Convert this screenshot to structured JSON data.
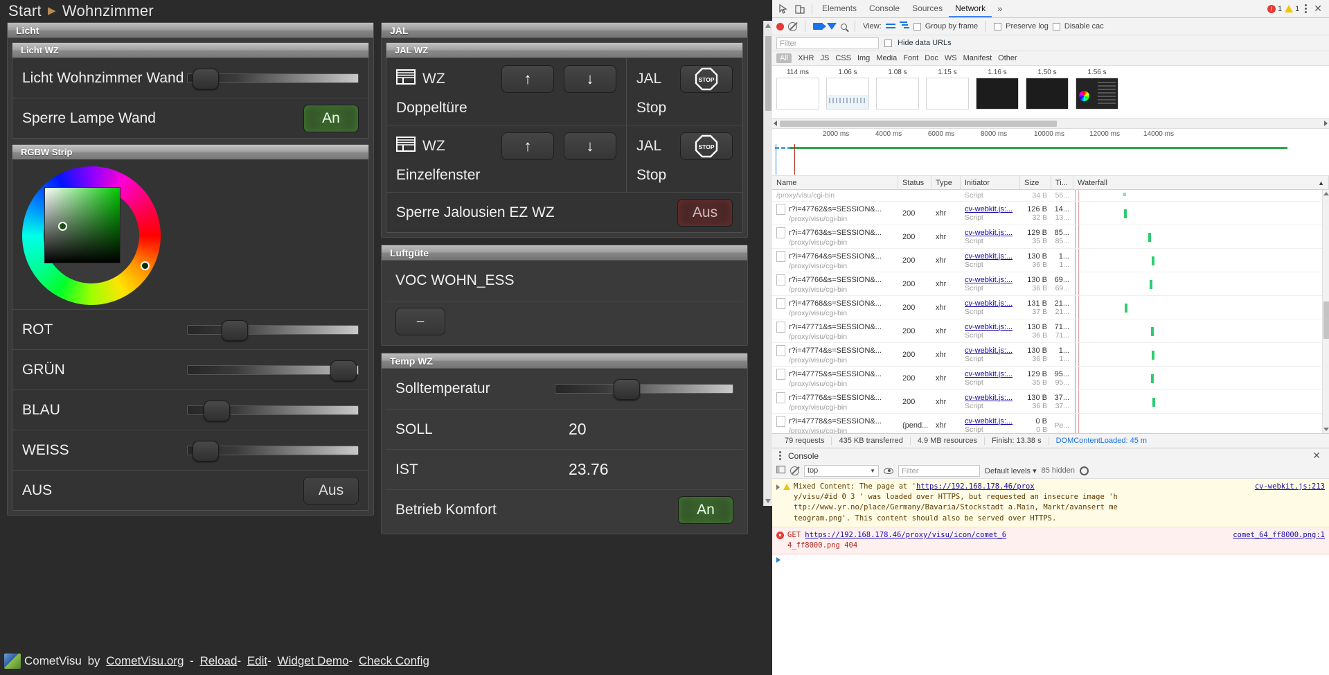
{
  "cometvisu": {
    "breadcrumb": {
      "root": "Start",
      "separator": "▶",
      "current": "Wohnzimmer"
    },
    "groups": {
      "licht": {
        "title": "Licht",
        "subgroups": [
          {
            "title": "Licht WZ",
            "rows": [
              {
                "label": "Licht Wohnzimmer Wand",
                "type": "slider",
                "knob_percent": 8
              },
              {
                "label": "Sperre Lampe Wand",
                "type": "switch",
                "value": "An",
                "state": "on"
              }
            ]
          },
          {
            "title": "RGBW Strip",
            "rows": [
              {
                "label": "ROT",
                "type": "slider",
                "knob_percent": 21
              },
              {
                "label": "GRÜN",
                "type": "slider",
                "knob_percent": 85
              },
              {
                "label": "BLAU",
                "type": "slider",
                "knob_percent": 13
              },
              {
                "label": "WEISS",
                "type": "slider",
                "knob_percent": 8
              },
              {
                "label": "AUS",
                "type": "switch",
                "value": "Aus",
                "state": "plain"
              }
            ]
          }
        ]
      },
      "jal": {
        "title": "JAL",
        "subgroup_title": "JAL WZ",
        "rows": [
          {
            "icon": "blinds-icon",
            "title": "WZ",
            "subtitle": "Doppeltüre",
            "up_label": "↑",
            "down_label": "↓",
            "right_title": "JAL",
            "right_subtitle": "Stop",
            "stop_label": "STOP"
          },
          {
            "icon": "blinds-icon",
            "title": "WZ",
            "subtitle": "Einzelfenster",
            "up_label": "↑",
            "down_label": "↓",
            "right_title": "JAL",
            "right_subtitle": "Stop",
            "stop_label": "STOP"
          }
        ],
        "lock_row": {
          "label": "Sperre Jalousien EZ WZ",
          "value": "Aus",
          "state": "off-red"
        }
      },
      "luftguete": {
        "title": "Luftgüte",
        "sensor_label": "VOC WOHN_ESS",
        "button_label": "–"
      },
      "temp": {
        "title": "Temp WZ",
        "rows": [
          {
            "label": "Solltemperatur",
            "type": "slider",
            "knob_percent": 35
          },
          {
            "label": "SOLL",
            "type": "value",
            "value": "20"
          },
          {
            "label": "IST",
            "type": "value",
            "value": "23.76"
          },
          {
            "label": "Betrieb Komfort",
            "type": "switch",
            "value": "An",
            "state": "on"
          }
        ]
      }
    },
    "footer": {
      "product": "CometVisu",
      "by": "by",
      "site": "CometVisu.org",
      "links": [
        "Reload",
        "Edit",
        "Widget Demo",
        "Check Config"
      ],
      "dash": "-"
    }
  },
  "devtools": {
    "tabs": [
      {
        "label": "Elements",
        "active": false
      },
      {
        "label": "Console",
        "active": false
      },
      {
        "label": "Sources",
        "active": false
      },
      {
        "label": "Network",
        "active": true
      }
    ],
    "more_label": "»",
    "error_count": "1",
    "warning_count": "1",
    "close_label": "✕",
    "toolbar": {
      "view_label": "View:",
      "group_by_frame": "Group by frame",
      "preserve_log": "Preserve log",
      "disable_cache": "Disable cac"
    },
    "filter": {
      "placeholder": "Filter",
      "hide_data_urls": "Hide data URLs"
    },
    "types": [
      "All",
      "XHR",
      "JS",
      "CSS",
      "Img",
      "Media",
      "Font",
      "Doc",
      "WS",
      "Manifest",
      "Other"
    ],
    "active_type": "All",
    "filmstrip": [
      {
        "time": "114 ms",
        "kind": "blank"
      },
      {
        "time": "1.06 s",
        "kind": "chart"
      },
      {
        "time": "1.08 s",
        "kind": "blank"
      },
      {
        "time": "1.15 s",
        "kind": "blank"
      },
      {
        "time": "1.16 s",
        "kind": "dark"
      },
      {
        "time": "1.50 s",
        "kind": "dark"
      },
      {
        "time": "1.56 s",
        "kind": "cv"
      }
    ],
    "overview_ticks": [
      "2000 ms",
      "4000 ms",
      "6000 ms",
      "8000 ms",
      "10000 ms",
      "12000 ms",
      "14000 ms"
    ],
    "table": {
      "columns": [
        "Name",
        "Status",
        "Type",
        "Initiator",
        "Size",
        "Ti...",
        "Waterfall"
      ],
      "rows": [
        {
          "name": "",
          "path": "/proxy/visu/cgi-bin",
          "status": "",
          "type": "",
          "initiator": "",
          "initiator_sub": "Script",
          "size": "34 B",
          "size_sub": "",
          "time": "56...",
          "time_sub": "",
          "partial": true
        },
        {
          "name": "r?i=47762&s=SESSION&...",
          "path": "/proxy/visu/cgi-bin",
          "status": "200",
          "type": "xhr",
          "initiator": "cv-webkit.js:...",
          "initiator_sub": "Script",
          "size": "126 B",
          "size_sub": "32 B",
          "time": "14...",
          "time_sub": "13...",
          "partial": false
        },
        {
          "name": "r?i=47763&s=SESSION&...",
          "path": "/proxy/visu/cgi-bin",
          "status": "200",
          "type": "xhr",
          "initiator": "cv-webkit.js:...",
          "initiator_sub": "Script",
          "size": "129 B",
          "size_sub": "35 B",
          "time": "85...",
          "time_sub": "85...",
          "partial": false
        },
        {
          "name": "r?i=47764&s=SESSION&...",
          "path": "/proxy/visu/cgi-bin",
          "status": "200",
          "type": "xhr",
          "initiator": "cv-webkit.js:...",
          "initiator_sub": "Script",
          "size": "130 B",
          "size_sub": "36 B",
          "time": "1...",
          "time_sub": "1...",
          "partial": false
        },
        {
          "name": "r?i=47766&s=SESSION&...",
          "path": "/proxy/visu/cgi-bin",
          "status": "200",
          "type": "xhr",
          "initiator": "cv-webkit.js:...",
          "initiator_sub": "Script",
          "size": "130 B",
          "size_sub": "36 B",
          "time": "69...",
          "time_sub": "69...",
          "partial": false
        },
        {
          "name": "r?i=47768&s=SESSION&...",
          "path": "/proxy/visu/cgi-bin",
          "status": "200",
          "type": "xhr",
          "initiator": "cv-webkit.js:...",
          "initiator_sub": "Script",
          "size": "131 B",
          "size_sub": "37 B",
          "time": "21...",
          "time_sub": "21...",
          "partial": false
        },
        {
          "name": "r?i=47771&s=SESSION&...",
          "path": "/proxy/visu/cgi-bin",
          "status": "200",
          "type": "xhr",
          "initiator": "cv-webkit.js:...",
          "initiator_sub": "Script",
          "size": "130 B",
          "size_sub": "36 B",
          "time": "71...",
          "time_sub": "71...",
          "partial": false
        },
        {
          "name": "r?i=47774&s=SESSION&...",
          "path": "/proxy/visu/cgi-bin",
          "status": "200",
          "type": "xhr",
          "initiator": "cv-webkit.js:...",
          "initiator_sub": "Script",
          "size": "130 B",
          "size_sub": "36 B",
          "time": "1...",
          "time_sub": "1...",
          "partial": false
        },
        {
          "name": "r?i=47775&s=SESSION&...",
          "path": "/proxy/visu/cgi-bin",
          "status": "200",
          "type": "xhr",
          "initiator": "cv-webkit.js:...",
          "initiator_sub": "Script",
          "size": "129 B",
          "size_sub": "35 B",
          "time": "95...",
          "time_sub": "95...",
          "partial": false
        },
        {
          "name": "r?i=47776&s=SESSION&...",
          "path": "/proxy/visu/cgi-bin",
          "status": "200",
          "type": "xhr",
          "initiator": "cv-webkit.js:...",
          "initiator_sub": "Script",
          "size": "130 B",
          "size_sub": "36 B",
          "time": "37...",
          "time_sub": "37...",
          "partial": false
        },
        {
          "name": "r?i=47778&s=SESSION&...",
          "path": "/proxy/visu/cgi-bin",
          "status": "(pend...",
          "type": "xhr",
          "initiator": "cv-webkit.js:...",
          "initiator_sub": "Script",
          "size": "0 B",
          "size_sub": "0 B",
          "time": "Pe...",
          "time_sub": "",
          "partial": false
        }
      ]
    },
    "summary": {
      "requests": "79 requests",
      "transferred": "435 KB transferred",
      "resources": "4.9 MB resources",
      "finish": "Finish: 13.38 s",
      "domcontentloaded": "DOMContentLoaded: 45 m"
    },
    "console": {
      "title": "Console",
      "context": "top",
      "filter_placeholder": "Filter",
      "levels": "Default levels ▾",
      "hidden_count": "85 hidden",
      "messages": [
        {
          "type": "warn",
          "text_parts": [
            {
              "t": "Mixed Content: The page at '",
              "link": false
            },
            {
              "t": "https://192.168.178.46/prox",
              "link": true
            },
            {
              "t": "  cv-webkit.js:213",
              "link": false
            }
          ],
          "line2": "y/visu/#id 0 3 ' was loaded over HTTPS, but requested an insecure image 'h",
          "line3": "ttp://www.yr.no/place/Germany/Bavaria/Stockstadt a.Main, Markt/avansert me",
          "line4": "teogram.png'. This content should also be served over HTTPS."
        },
        {
          "type": "err",
          "prefix": "GET ",
          "link": "https://192.168.178.46/proxy/visu/icon/comet_6",
          "tail": "  comet_64_ff8000.png:1",
          "line2": "4_ff8000.png 404"
        }
      ]
    }
  }
}
